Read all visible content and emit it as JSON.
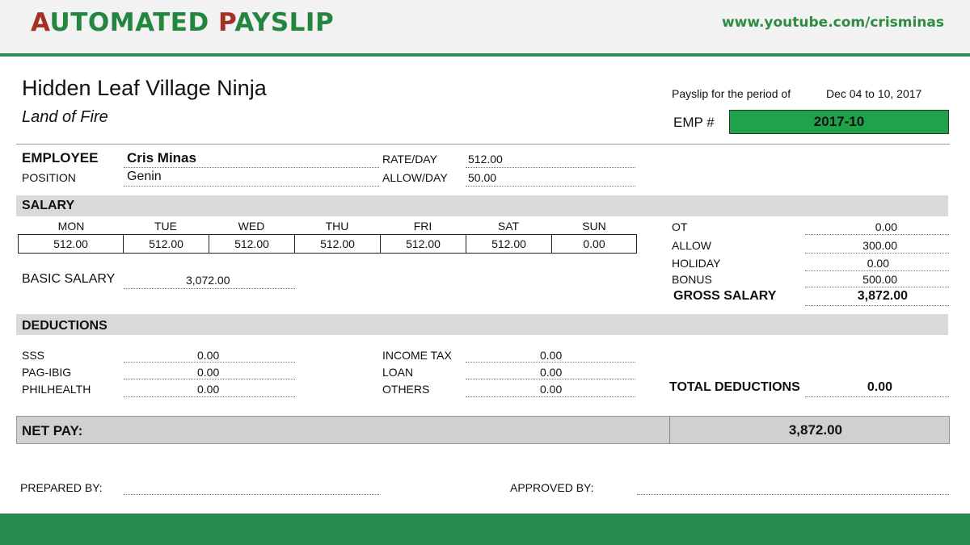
{
  "header": {
    "title_a1": "A",
    "title_rest1": "UTOMATED ",
    "title_p": "P",
    "title_rest2": "AYSLIP",
    "youtube": "www.youtube.com/crisminas"
  },
  "company": {
    "name": "Hidden Leaf Village Ninja",
    "location": "Land of Fire"
  },
  "period": {
    "label": "Payslip for the period of",
    "value": "Dec 04 to 10, 2017"
  },
  "emp": {
    "label": "EMP #",
    "value": "2017-10"
  },
  "employee": {
    "label": "EMPLOYEE",
    "name": "Cris Minas",
    "position_label": "POSITION",
    "position": "Genin",
    "rate_label": "RATE/DAY",
    "rate": "512.00",
    "allow_label": "ALLOW/DAY",
    "allow": "50.00"
  },
  "salary": {
    "title": "SALARY",
    "days": [
      {
        "day": "MON",
        "value": "512.00"
      },
      {
        "day": "TUE",
        "value": "512.00"
      },
      {
        "day": "WED",
        "value": "512.00"
      },
      {
        "day": "THU",
        "value": "512.00"
      },
      {
        "day": "FRI",
        "value": "512.00"
      },
      {
        "day": "SAT",
        "value": "512.00"
      },
      {
        "day": "SUN",
        "value": "0.00"
      }
    ],
    "basic_label": "BASIC SALARY",
    "basic": "3,072.00",
    "ot_label": "OT",
    "ot": "0.00",
    "allow_label": "ALLOW",
    "allow": "300.00",
    "holiday_label": "HOLIDAY",
    "holiday": "0.00",
    "bonus_label": "BONUS",
    "bonus": "500.00",
    "gross_label": "GROSS SALARY",
    "gross": "3,872.00"
  },
  "deductions": {
    "title": "DEDUCTIONS",
    "sss_label": "SSS",
    "sss": "0.00",
    "pagibig_label": "PAG-IBIG",
    "pagibig": "0.00",
    "philhealth_label": "PHILHEALTH",
    "philhealth": "0.00",
    "tax_label": "INCOME TAX",
    "tax": "0.00",
    "loan_label": "LOAN",
    "loan": "0.00",
    "others_label": "OTHERS",
    "others": "0.00",
    "total_label": "TOTAL DEDUCTIONS",
    "total": "0.00"
  },
  "net": {
    "label": "NET PAY:",
    "value": "3,872.00"
  },
  "footer": {
    "prepared_label": "PREPARED BY:",
    "approved_label": "APPROVED BY:"
  },
  "colors": {
    "brand_green": "#268a50",
    "title_red": "#a33224",
    "emp_green": "#1fa34a"
  }
}
